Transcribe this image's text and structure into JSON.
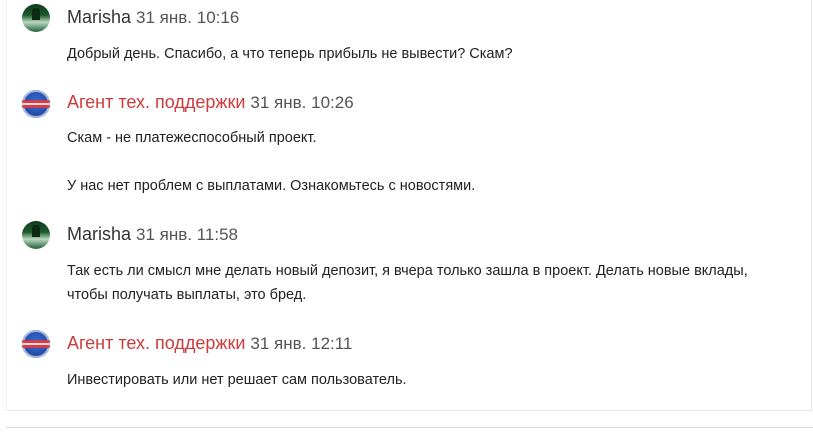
{
  "messages": [
    {
      "author": "Marisha",
      "time": "31 янв. 10:16",
      "role": "user",
      "lines": [
        "Добрый день. Спасибо, а что теперь прибыль не вывести? Скам?"
      ]
    },
    {
      "author": "Агент тех. поддержки",
      "time": "31 янв. 10:26",
      "role": "support",
      "lines": [
        "Скам - не платежеспособный проект.",
        "",
        "У нас нет проблем с выплатами. Ознакомьтесь с новостями."
      ]
    },
    {
      "author": "Marisha",
      "time": "31 янв. 11:58",
      "role": "user",
      "lines": [
        "Так есть ли смысл мне делать новый депозит, я вчера только зашла в проект. Делать новые вклады,",
        "чтобы получать выплаты, это бред."
      ]
    },
    {
      "author": "Агент тех. поддержки",
      "time": "31 янв. 12:11",
      "role": "support",
      "lines": [
        "Инвестировать или нет решает сам пользователь."
      ]
    }
  ],
  "colors": {
    "support_author": "#cc3b3b",
    "user_author": "#333333",
    "timestamp": "#555555"
  }
}
